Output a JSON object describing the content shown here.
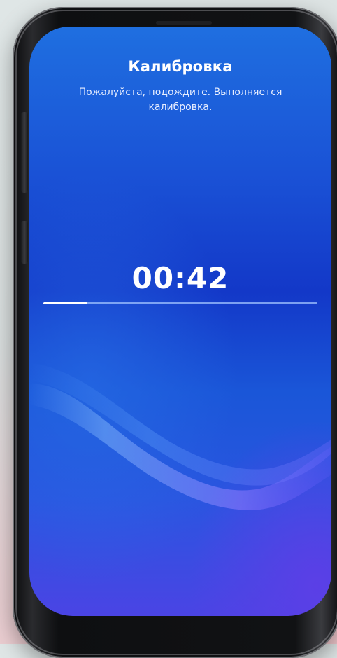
{
  "screen": {
    "title": "Калибровка",
    "subtitle": "Пожалуйста, подождите. Выполняется калибровка.",
    "timer": "00:42",
    "progress": 0.16
  },
  "colors": {
    "background_top": "#1f6fe0",
    "background_bottom": "#4a44e4",
    "text": "#ffffff",
    "progress_track": "#a0c3ff",
    "progress_fill": "#ffffff"
  }
}
